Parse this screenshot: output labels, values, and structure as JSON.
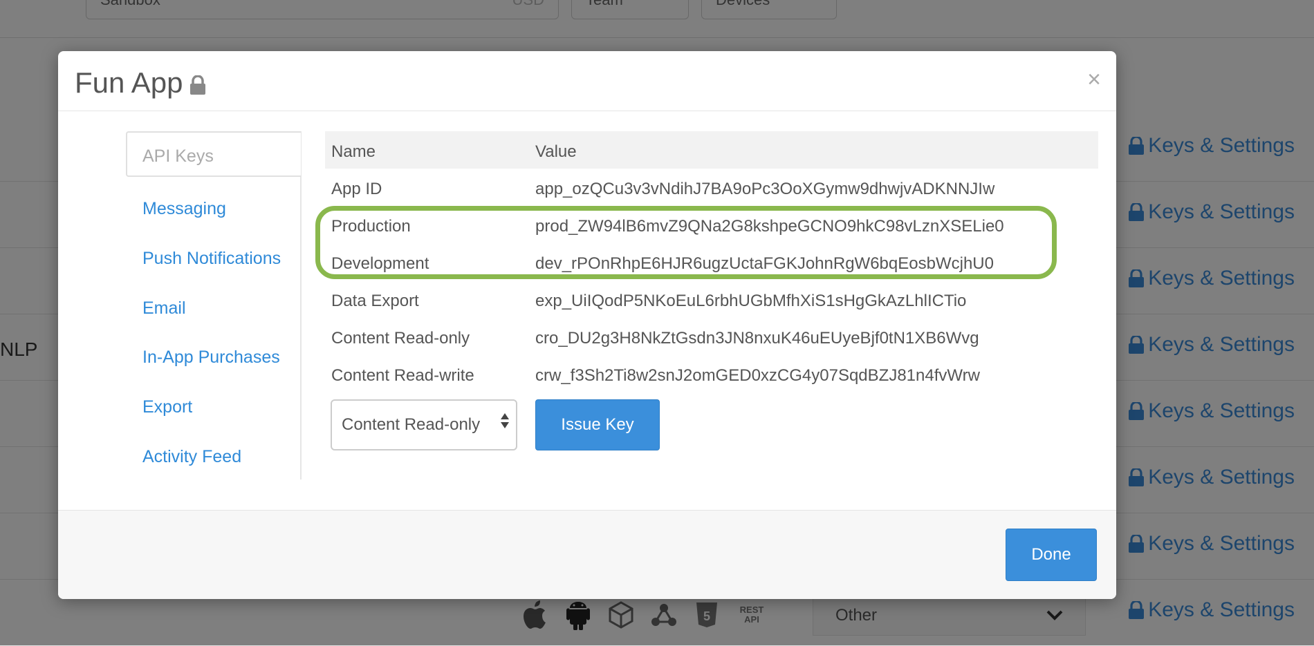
{
  "background": {
    "top_pills": [
      {
        "label": "Sandbox",
        "suffix": "USD"
      },
      {
        "label": "Team"
      },
      {
        "label": "Devices"
      }
    ],
    "row_link_label": "Keys & Settings",
    "nlp_label": "NLP",
    "platform_icons": [
      "apple-icon",
      "android-icon",
      "unity-icon",
      "xamarin-icon",
      "html5-icon",
      "rest-api-icon"
    ],
    "rest_api_text": "REST API",
    "html5_text": "5",
    "other_select_value": "Other"
  },
  "modal": {
    "title": "Fun App",
    "close_label": "×",
    "sidebar": {
      "active": "API Keys",
      "items": [
        "Messaging",
        "Push Notifications",
        "Email",
        "In-App Purchases",
        "Export",
        "Activity Feed"
      ]
    },
    "table": {
      "headers": {
        "name": "Name",
        "value": "Value"
      },
      "rows": [
        {
          "name": "App ID",
          "value": "app_ozQCu3v3vNdihJ7BA9oPc3OoXGymw9dhwjvADKNNJIw"
        },
        {
          "name": "Production",
          "value": "prod_ZW94lB6mvZ9QNa2G8kshpeGCNO9hkC98vLznXSELie0"
        },
        {
          "name": "Development",
          "value": "dev_rPOnRhpE6HJR6ugzUctaFGKJohnRgW6bqEosbWcjhU0"
        },
        {
          "name": "Data Export",
          "value": "exp_UiIQodP5NKoEuL6rbhUGbMfhXiS1sHgGkAzLhlICTio"
        },
        {
          "name": "Content Read-only",
          "value": "cro_DU2g3H8NkZtGsdn3JN8nxuK46uEUyeBjf0tN1XB6Wvg"
        },
        {
          "name": "Content Read-write",
          "value": "crw_f3Sh2Ti8w2snJ2omGED0xzCG4y07SqdBZJ81n4fvWrw"
        }
      ]
    },
    "key_type_select": "Content Read-only",
    "issue_key_label": "Issue Key",
    "done_label": "Done"
  },
  "colors": {
    "accent_blue": "#3b8fdb",
    "highlight_green": "#8ab84d",
    "link_blue": "#2f8ad8"
  }
}
